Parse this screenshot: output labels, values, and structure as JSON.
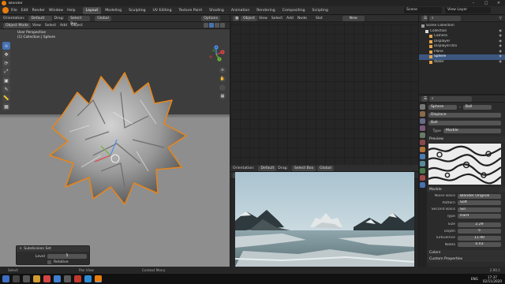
{
  "window": {
    "title": "Blender",
    "controls": [
      "–",
      "□",
      "✕"
    ]
  },
  "menu": [
    "File",
    "Edit",
    "Render",
    "Window",
    "Help"
  ],
  "workspaces": [
    "Layout",
    "Modeling",
    "Sculpting",
    "UV Editing",
    "Texture Paint",
    "Shading",
    "Animation",
    "Rendering",
    "Compositing",
    "Scripting"
  ],
  "active_workspace": "Layout",
  "scene": {
    "label": "Scene",
    "view_layer": "View Layer"
  },
  "viewport": {
    "tool_header": {
      "orientation_label": "Orientation:",
      "orientation_value": "Default",
      "drag_label": "Drag:",
      "drag_value": "Select Box",
      "transform": "Global",
      "options": "Options"
    },
    "header": {
      "mode": "Object Mode",
      "view": "View",
      "select": "Select",
      "add": "Add",
      "object": "Object"
    },
    "info_line1": "User Perspective",
    "info_line2": "(1) Collection | Sphere",
    "gizmo": {
      "x": "X",
      "y": "Y",
      "z": "Z"
    },
    "tools": [
      "⊹",
      "✥",
      "⟳",
      "⤢",
      "▣",
      "✎",
      "📏",
      "▦"
    ],
    "nav_buttons": [
      "+",
      "✋",
      "🎥",
      "▦"
    ]
  },
  "operator_panel": {
    "title": "Subdivision Set",
    "level_label": "Level",
    "level_value": "5",
    "relative_label": "Relative"
  },
  "node_editor": {
    "mode": "Object",
    "view": "View",
    "select": "Select",
    "add": "Add",
    "node": "Node",
    "slot": "Slot",
    "new_button": "New"
  },
  "image_editor": {
    "tool_header": {
      "orientation_label": "Orientation:",
      "orientation_value": "Default",
      "drag_label": "Drag:",
      "drag_value": "Select Box",
      "transform": "Global"
    },
    "header": {
      "mode": "Object Mode",
      "view": "View",
      "select": "Select",
      "add": "Add",
      "object": "Object"
    }
  },
  "outliner": {
    "items": [
      {
        "label": "Scene Collection",
        "indent": 0,
        "color": "#9a9a9a",
        "selected": false
      },
      {
        "label": "Collection",
        "indent": 1,
        "color": "#d8d8d8",
        "selected": false
      },
      {
        "label": "Camera",
        "indent": 2,
        "color": "#e8a34b",
        "selected": false
      },
      {
        "label": "Displayer",
        "indent": 2,
        "color": "#e8a34b",
        "selected": false
      },
      {
        "label": "Displayer.001",
        "indent": 2,
        "color": "#e8a34b",
        "selected": false
      },
      {
        "label": "Plane",
        "indent": 2,
        "color": "#e8a34b",
        "selected": false
      },
      {
        "label": "Sphere",
        "indent": 2,
        "color": "#e8a34b",
        "selected": true
      },
      {
        "label": "Water",
        "indent": 2,
        "color": "#e8a34b",
        "selected": false
      }
    ]
  },
  "properties": {
    "object_name": "Sphere",
    "texture_slot": "Ball",
    "modifier": "Displace",
    "texture_name": "Ball",
    "type_label": "Type",
    "type_value": "Marble",
    "preview_label": "Preview",
    "marble_label": "Marble",
    "noise_basis_label": "Noise Basis",
    "noise_basis_value": "Blender Original",
    "pattern_label": "Pattern",
    "pattern_value": "Soft",
    "second_basis_label": "Second Basis",
    "second_basis_value": "Sin",
    "type2_label": "Type",
    "type2_value": "Hard",
    "size_label": "Size",
    "size_value": "2.29",
    "depth_label": "Depth",
    "depth_value": "5",
    "turbulence_label": "Turbulence",
    "turbulence_value": "11.90",
    "nabla_label": "Nabla",
    "nabla_value": "0.03",
    "colors_label": "Colors",
    "custom_props_label": "Custom Properties"
  },
  "statusbar": {
    "left": "Select",
    "middle1": "Pan View",
    "middle2": "Context Menu",
    "version": "2.90.1"
  },
  "taskbar": {
    "time": "17:37",
    "date": "02/11/2020",
    "language": "ENG"
  },
  "colors": {
    "accent": "#4772b3",
    "orange": "#e87d0d",
    "selected_row": "#3b5780"
  }
}
